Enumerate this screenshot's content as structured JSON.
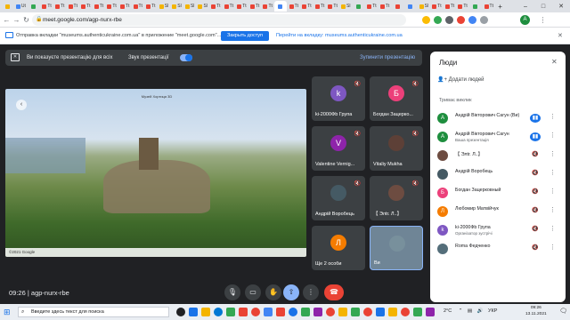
{
  "browser": {
    "tabs": [
      {
        "label": "",
        "color": "#f4b400"
      },
      {
        "label": "Ut",
        "color": "#4285f4"
      },
      {
        "label": "",
        "color": "#34a853"
      },
      {
        "label": "Tt",
        "color": "#ea4335"
      },
      {
        "label": "Tt",
        "color": "#ea4335"
      },
      {
        "label": "Tt",
        "color": "#ea4335"
      },
      {
        "label": "Tt",
        "color": "#ea4335"
      },
      {
        "label": "Tt",
        "color": "#ea4335"
      },
      {
        "label": "Tt",
        "color": "#ea4335"
      },
      {
        "label": "Tt",
        "color": "#ea4335"
      },
      {
        "label": "Tt",
        "color": "#ea4335"
      },
      {
        "label": "Tt",
        "color": "#ea4335"
      },
      {
        "label": "Sl",
        "color": "#f4b400"
      },
      {
        "label": "Sl",
        "color": "#f4b400"
      },
      {
        "label": "Sl",
        "color": "#f4b400"
      },
      {
        "label": "Sl",
        "color": "#f4b400"
      },
      {
        "label": "Tt",
        "color": "#ea4335"
      },
      {
        "label": "Tt",
        "color": "#ea4335"
      },
      {
        "label": "Tt",
        "color": "#ea4335"
      },
      {
        "label": "Tt",
        "color": "#ea4335"
      },
      {
        "label": "Tt",
        "color": "#ea4335"
      },
      {
        "label": "",
        "color": "#4285f4"
      },
      {
        "label": "Tt",
        "color": "#ea4335"
      },
      {
        "label": "Tt",
        "color": "#ea4335"
      },
      {
        "label": "Tt",
        "color": "#ea4335"
      },
      {
        "label": "Tt",
        "color": "#ea4335"
      },
      {
        "label": "Sl",
        "color": "#f4b400"
      },
      {
        "label": "",
        "color": "#34a853"
      },
      {
        "label": "Tt",
        "color": "#ea4335"
      },
      {
        "label": "Tt",
        "color": "#ea4335"
      },
      {
        "label": "",
        "color": "#ea4335"
      },
      {
        "label": "",
        "color": "#4285f4"
      },
      {
        "label": "Sl",
        "color": "#f4b400"
      },
      {
        "label": "Tt",
        "color": "#ea4335"
      },
      {
        "label": "Tt",
        "color": "#ea4335"
      },
      {
        "label": "Tt",
        "color": "#ea4335"
      },
      {
        "label": "",
        "color": "#34a853"
      },
      {
        "label": "Tt",
        "color": "#ea4335"
      }
    ],
    "new_tab": "+",
    "url": "meet.google.com/agp-nurx-rbe",
    "account_initial": "A",
    "win_controls": {
      "min": "–",
      "max": "□",
      "close": "✕"
    }
  },
  "infobar": {
    "text": "Отправка вкладки \"museums.authenticukraine.com.ua\" в приложение \"meet.google.com\"...",
    "access_button": "Закрыть доступ",
    "switch_link": "Перейти на вкладку: museums.authenticukraine.com.ua",
    "close": "✕"
  },
  "presentation_bar": {
    "showing_text": "Ви показуєте презентацію для всіх",
    "sound_label": "Звук презентації",
    "stop_label": "Зупинити презентацію"
  },
  "presentation": {
    "logo_text": "Музей Хортиця 3D",
    "footer": "©2021 Google"
  },
  "tiles": [
    {
      "name": "ki-2000Фb Група",
      "initial": "k",
      "color": "#7e57c2",
      "muted": true
    },
    {
      "name": "Богдан Зацерко...",
      "initial": "Б",
      "color": "#ec407a",
      "muted": true
    },
    {
      "name": "Valentine Vernig...",
      "initial": "V",
      "color": "#8e24aa",
      "muted": true
    },
    {
      "name": "Vitaliy Mukha",
      "initial": "",
      "color": "#5d4037",
      "muted": true
    },
    {
      "name": "Андрій Воробець",
      "initial": "",
      "color": "#455a64",
      "muted": true
    },
    {
      "name": "【 Элtг. Л..】",
      "initial": "",
      "color": "#6d4c41",
      "muted": true
    },
    {
      "name": "Ще 2 особи",
      "initial": "Л",
      "color": "#f57c00",
      "muted": false
    },
    {
      "name": "Ви",
      "initial": "",
      "color": "#78909c",
      "muted": false
    }
  ],
  "bottom_bar": {
    "time": "09:26",
    "meeting_code": "agp-nurx-rbe",
    "people_count": "10"
  },
  "people_panel": {
    "title": "Люди",
    "add_people": "Додати людей",
    "section": "Триває виклик",
    "participants": [
      {
        "name": "Андрій Вікторович Сагун  (Ви)",
        "sub": "",
        "initial": "A",
        "color": "#1e8e3e",
        "active": true
      },
      {
        "name": "Андрій Вікторович Сагун",
        "sub": "Ваша презентація",
        "initial": "A",
        "color": "#1e8e3e",
        "active": true
      },
      {
        "name": "【 Элtг. Л..】",
        "sub": "",
        "initial": "",
        "color": "#6d4c41",
        "active": false
      },
      {
        "name": "Андрій Воробець",
        "sub": "",
        "initial": "",
        "color": "#455a64",
        "active": false
      },
      {
        "name": "Богдан Зацерковный",
        "sub": "",
        "initial": "Б",
        "color": "#ec407a",
        "active": false
      },
      {
        "name": "Любомир Матвійчук",
        "sub": "",
        "initial": "Л",
        "color": "#f57c00",
        "active": false
      },
      {
        "name": "ki-2000Фb Група",
        "sub": "Організатор зустрічі",
        "initial": "k",
        "color": "#7e57c2",
        "active": false
      },
      {
        "name": "Roma Федченко",
        "sub": "",
        "initial": "",
        "color": "#546e7a",
        "active": false
      }
    ]
  },
  "taskbar": {
    "search_placeholder": "Введите здесь текст для поиска",
    "temperature": "2°C",
    "lang": "УКР",
    "time": "09:26",
    "date": "13.11.2021"
  }
}
